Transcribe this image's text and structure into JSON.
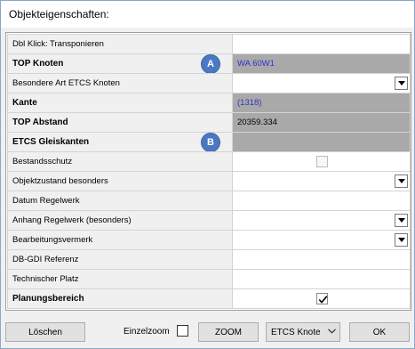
{
  "window": {
    "title": "Objekteigenschaften:"
  },
  "grid": {
    "rows": [
      {
        "label": "Dbl Klick: Transponieren",
        "bold": false,
        "value": "",
        "value_style": "white",
        "control": "none"
      },
      {
        "label": "TOP Knoten",
        "bold": true,
        "value": "WA 60W1",
        "value_style": "gray-blue",
        "control": "none",
        "badge": "A"
      },
      {
        "label": "Besondere Art ETCS Knoten",
        "bold": false,
        "value": "",
        "value_style": "white",
        "control": "dropdown"
      },
      {
        "label": "Kante",
        "bold": true,
        "value": "(1318)",
        "value_style": "gray-blue",
        "control": "none"
      },
      {
        "label": "TOP Abstand",
        "bold": true,
        "value": "20359.334",
        "value_style": "gray",
        "control": "none"
      },
      {
        "label": "ETCS Gleiskanten",
        "bold": true,
        "value": "",
        "value_style": "gray",
        "control": "none",
        "badge": "B"
      },
      {
        "label": "Bestandsschutz",
        "bold": false,
        "value": "",
        "value_style": "white",
        "control": "checkbox-disabled",
        "checked": false
      },
      {
        "label": "Objektzustand besonders",
        "bold": false,
        "value": "",
        "value_style": "white",
        "control": "dropdown"
      },
      {
        "label": "Datum Regelwerk",
        "bold": false,
        "value": "",
        "value_style": "white",
        "control": "none"
      },
      {
        "label": "Anhang Regelwerk (besonders)",
        "bold": false,
        "value": "",
        "value_style": "white",
        "control": "dropdown"
      },
      {
        "label": "Bearbeitungsvermerk",
        "bold": false,
        "value": "",
        "value_style": "white",
        "control": "dropdown"
      },
      {
        "label": "DB-GDI Referenz",
        "bold": false,
        "value": "",
        "value_style": "white",
        "control": "none"
      },
      {
        "label": "Technischer Platz",
        "bold": false,
        "value": "",
        "value_style": "white",
        "control": "none"
      },
      {
        "label": "Planungsbereich",
        "bold": true,
        "value": "",
        "value_style": "white",
        "control": "checkbox",
        "checked": true
      }
    ]
  },
  "footer": {
    "loeschen_label": "Löschen",
    "einzelzoom_label": "Einzelzoom",
    "einzelzoom_checked": false,
    "zoom_label": "ZOOM",
    "combo_value": "ETCS Knote",
    "ok_label": "OK"
  },
  "colors": {
    "gray_cell": "#a9a9a9",
    "label_cell": "#f0f0f0",
    "blue_text": "#3333cc",
    "badge": "#4a78c2"
  }
}
